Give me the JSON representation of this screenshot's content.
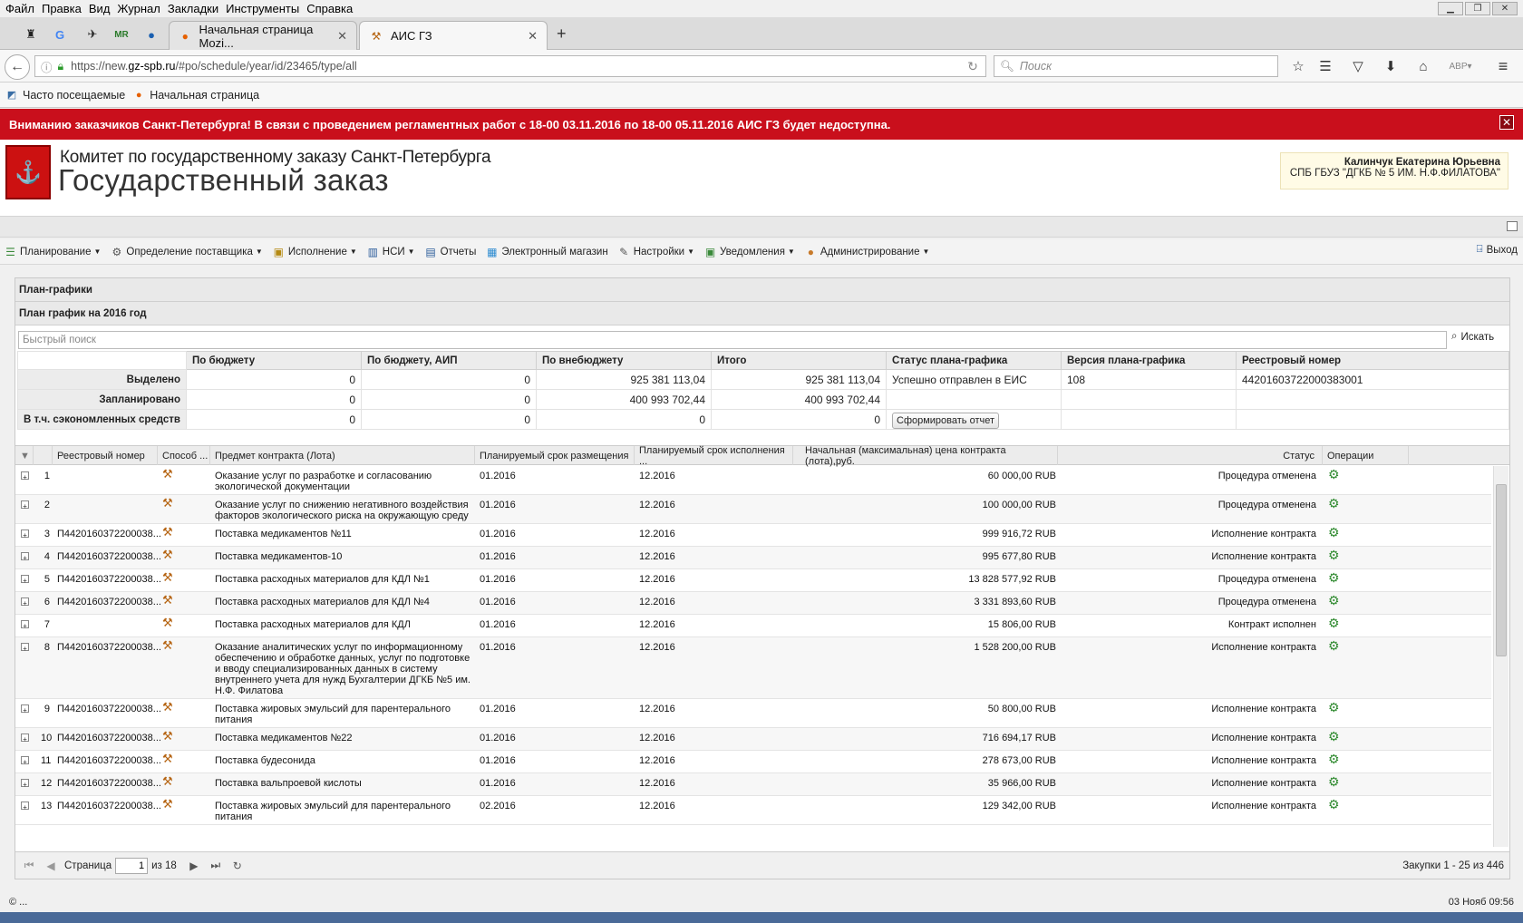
{
  "menubar": [
    "Файл",
    "Правка",
    "Вид",
    "Журнал",
    "Закладки",
    "Инструменты",
    "Справка"
  ],
  "tabs": [
    {
      "title": "Начальная страница Mozi..."
    },
    {
      "title": "АИС ГЗ"
    }
  ],
  "url": {
    "prefix": "https://new.",
    "host": "gz-spb.ru",
    "path": "/#po/schedule/year/id/23465/type/all"
  },
  "search_placeholder": "Поиск",
  "bookmarks": [
    "Часто посещаемые",
    "Начальная страница"
  ],
  "notice": "Вниманию заказчиков Санкт-Петербурга! В связи с проведением регламентных работ с 18-00 03.11.2016 по 18-00 05.11.2016 АИС ГЗ будет недоступна.",
  "header": {
    "org": "Комитет по государственному заказу Санкт-Петербурга",
    "title": "Государственный заказ"
  },
  "user": {
    "name": "Калинчук Екатерина Юрьевна",
    "org": "СПБ ГБУЗ \"ДГКБ № 5 ИМ. Н.Ф.ФИЛАТОВА\""
  },
  "appmenu": [
    "Планирование",
    "Определение поставщика",
    "Исполнение",
    "НСИ",
    "Отчеты",
    "Электронный магазин",
    "Настройки",
    "Уведомления",
    "Администрирование"
  ],
  "exit": "Выход",
  "panel": {
    "title": "План-графики",
    "subtitle": "План график на 2016 год",
    "search_placeholder": "Быстрый поиск",
    "search_button": "Искать"
  },
  "summary": {
    "headers": [
      "По бюджету",
      "По бюджету, АИП",
      "По внебюджету",
      "Итого",
      "Статус плана-графика",
      "Версия плана-графика",
      "Реестровый номер"
    ],
    "rows": [
      {
        "label": "Выделено",
        "values": [
          "0",
          "0",
          "925 381 113,04",
          "925 381 113,04"
        ]
      },
      {
        "label": "Запланировано",
        "values": [
          "0",
          "0",
          "400 993 702,44",
          "400 993 702,44"
        ]
      },
      {
        "label": "В т.ч. сэкономленных средств",
        "values": [
          "0",
          "0",
          "0",
          "0"
        ]
      }
    ],
    "status": "Успешно отправлен в ЕИС",
    "version": "108",
    "registry": "44201603722000383001",
    "report_button": "Сформировать отчет"
  },
  "grid": {
    "headers": [
      "Реестровый номер",
      "Способ ...",
      "Предмет контракта (Лота)",
      "Планируемый срок размещения",
      "Планируемый срок исполнения ...",
      "Начальная (максимальная) цена контракта (лота),руб.",
      "Статус",
      "Операции"
    ],
    "rows": [
      {
        "n": "1",
        "reg": "",
        "subject": "Оказание услуг по разработке и согласованию экологической документации",
        "place": "01.2016",
        "exec": "12.2016",
        "price": "60 000,00 RUB",
        "status": "Процедура отменена"
      },
      {
        "n": "2",
        "reg": "",
        "subject": "Оказание услуг по снижению негативного воздействия факторов экологического риска на окружающую среду",
        "place": "01.2016",
        "exec": "12.2016",
        "price": "100 000,00 RUB",
        "status": "Процедура отменена"
      },
      {
        "n": "3",
        "reg": "П4420160372200038...",
        "subject": "Поставка медикаментов №11",
        "place": "01.2016",
        "exec": "12.2016",
        "price": "999 916,72 RUB",
        "status": "Исполнение контракта"
      },
      {
        "n": "4",
        "reg": "П4420160372200038...",
        "subject": "Поставка медикаментов-10",
        "place": "01.2016",
        "exec": "12.2016",
        "price": "995 677,80 RUB",
        "status": "Исполнение контракта"
      },
      {
        "n": "5",
        "reg": "П4420160372200038...",
        "subject": "Поставка расходных материалов для КДЛ №1",
        "place": "01.2016",
        "exec": "12.2016",
        "price": "13 828 577,92 RUB",
        "status": "Процедура отменена"
      },
      {
        "n": "6",
        "reg": "П4420160372200038...",
        "subject": "Поставка расходных материалов для КДЛ №4",
        "place": "01.2016",
        "exec": "12.2016",
        "price": "3 331 893,60 RUB",
        "status": "Процедура отменена"
      },
      {
        "n": "7",
        "reg": "",
        "subject": "Поставка расходных материалов для КДЛ",
        "place": "01.2016",
        "exec": "12.2016",
        "price": "15 806,00 RUB",
        "status": "Контракт исполнен"
      },
      {
        "n": "8",
        "reg": "П4420160372200038...",
        "subject": "Оказание аналитических услуг по информационному обеспечению и обработке данных, услуг по подготовке и вводу специализированных данных в систему внутреннего учета для нужд Бухгалтерии ДГКБ №5 им. Н.Ф. Филатова",
        "place": "01.2016",
        "exec": "12.2016",
        "price": "1 528 200,00 RUB",
        "status": "Исполнение контракта"
      },
      {
        "n": "9",
        "reg": "П4420160372200038...",
        "subject": "Поставка жировых эмульсий для парентерального питания",
        "place": "01.2016",
        "exec": "12.2016",
        "price": "50 800,00 RUB",
        "status": "Исполнение контракта"
      },
      {
        "n": "10",
        "reg": "П4420160372200038...",
        "subject": "Поставка медикаментов №22",
        "place": "01.2016",
        "exec": "12.2016",
        "price": "716 694,17 RUB",
        "status": "Исполнение контракта"
      },
      {
        "n": "11",
        "reg": "П4420160372200038...",
        "subject": "Поставка будесонида",
        "place": "01.2016",
        "exec": "12.2016",
        "price": "278 673,00 RUB",
        "status": "Исполнение контракта"
      },
      {
        "n": "12",
        "reg": "П4420160372200038...",
        "subject": "Поставка вальпроевой кислоты",
        "place": "01.2016",
        "exec": "12.2016",
        "price": "35 966,00 RUB",
        "status": "Исполнение контракта"
      },
      {
        "n": "13",
        "reg": "П4420160372200038...",
        "subject": "Поставка жировых эмульсий для парентерального питания",
        "place": "02.2016",
        "exec": "12.2016",
        "price": "129 342,00 RUB",
        "status": "Исполнение контракта"
      }
    ]
  },
  "pager": {
    "page_label": "Страница",
    "page": "1",
    "of": "из 18",
    "total": "Закупки 1 - 25 из 446"
  },
  "status": {
    "left": "© ...",
    "datetime": "03 Нояб 09:56"
  }
}
